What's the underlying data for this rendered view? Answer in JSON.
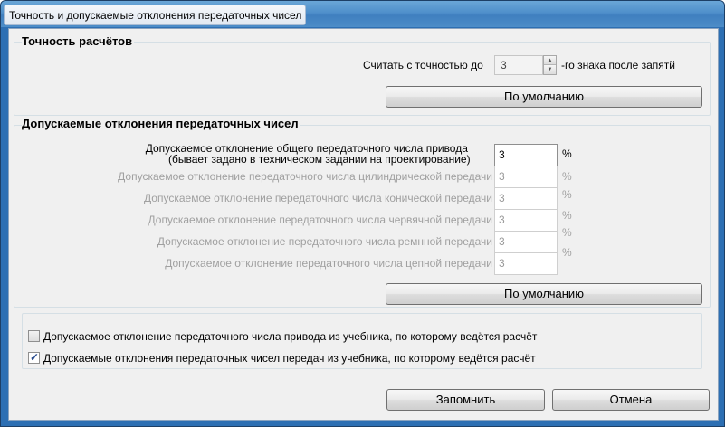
{
  "window": {
    "title": "Точность и допускаемые отклонения передаточных чисел"
  },
  "accuracy": {
    "title": "Точность расчётов",
    "prefix": "Считать с точностью до",
    "value": "3",
    "suffix": "-го знака после запятй",
    "default_button": "По умолчанию"
  },
  "deviations": {
    "title": "Допускаемые отклонения передаточных чисел",
    "total_label_line1": "Допускаемое отклонение общего передаточного числа привода",
    "total_label_line2": "(бывает задано в техническом задании на проектирование)",
    "total_value": "3",
    "unit": "%",
    "rows": [
      {
        "label": "Допускаемое отклонение передаточного числа цилиндрической передачи",
        "value": "3"
      },
      {
        "label": "Допускаемое отклонение передаточного числа конической передачи",
        "value": "3"
      },
      {
        "label": "Допускаемое отклонение передаточного числа червячной передачи",
        "value": "3"
      },
      {
        "label": "Допускаемое отклонение передаточного числа ремнной передачи",
        "value": "3"
      },
      {
        "label": "Допускаемое отклонение передаточного числа цепной передачи",
        "value": "3"
      }
    ],
    "default_button": "По умолчанию"
  },
  "options": {
    "option1": {
      "label": "Допускаемое отклонение передаточного числа привода из учебника, по которому ведётся расчёт",
      "checked": false
    },
    "option2": {
      "label": "Допускаемые отклонения передаточных чисел передач из учебника, по которому ведётся расчёт",
      "checked": true
    }
  },
  "footer": {
    "save_button": "Запомнить",
    "cancel_button": "Отмена"
  }
}
